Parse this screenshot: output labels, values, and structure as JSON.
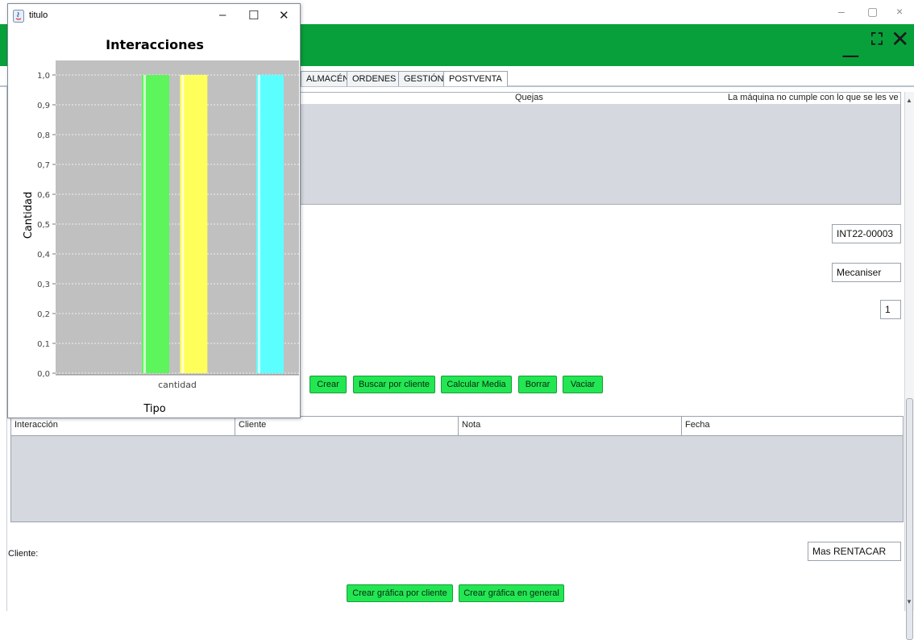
{
  "main_window": {
    "controls": {
      "minimize": "–",
      "maximize": "▢",
      "close": "×"
    },
    "header": {
      "minimize": "_",
      "expand": "⛶",
      "close": "✕",
      "color": "#08a03a"
    }
  },
  "tabs": [
    "ALMACÉN",
    "ORDENES",
    "GESTIÓN",
    "POSTVENTA"
  ],
  "active_tab": "POSTVENTA",
  "top_table": {
    "row": {
      "type": "Quejas",
      "description": "La máquina no cumple con lo que se les ven..."
    }
  },
  "fields": {
    "code": "INT22-00003",
    "company": "Mecaniser",
    "quantity": "1",
    "cliente_value": "Mas RENTACAR"
  },
  "buttons": {
    "crear": "Crear",
    "buscar_por_cliente": "Buscar por cliente",
    "calcular_media": "Calcular Media",
    "borrar": "Borrar",
    "vaciar": "Vaciar",
    "grafica_cliente": "Crear gráfica por cliente",
    "grafica_general": "Crear gráfica en general"
  },
  "grid": {
    "columns": [
      "Interacción",
      "Cliente",
      "Nota",
      "Fecha"
    ],
    "rows": []
  },
  "labels": {
    "cliente": "Cliente:"
  },
  "popup": {
    "title": "titulo",
    "controls": {
      "minimize": "–",
      "maximize": "☐",
      "close": "✕"
    },
    "icon": "java-icon"
  },
  "chart_data": {
    "type": "bar",
    "title": "Interacciones",
    "xlabel": "Tipo",
    "ylabel": "Cantidad",
    "categories": [
      "cantidad"
    ],
    "series": [
      {
        "values": [
          1.0
        ],
        "color": "#5cf55c"
      },
      {
        "values": [
          1.0
        ],
        "color": "#ffff5c"
      },
      {
        "values": [
          0
        ],
        "color": "#5c5cff"
      },
      {
        "values": [
          1.0
        ],
        "color": "#5cffff"
      }
    ],
    "yticks": [
      "0,0",
      "0,1",
      "0,2",
      "0,3",
      "0,4",
      "0,5",
      "0,6",
      "0,7",
      "0,8",
      "0,9",
      "1,0"
    ],
    "ylim": [
      0,
      1.0
    ],
    "grid": true,
    "plot_background": "#c0c0c0"
  }
}
